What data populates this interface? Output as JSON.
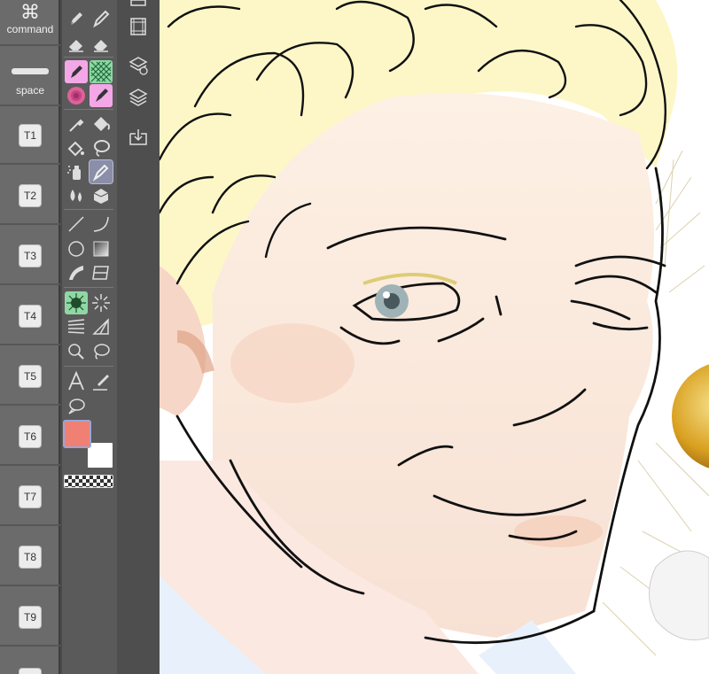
{
  "shortcuts": {
    "command": {
      "glyph": "⌘",
      "label": "command"
    },
    "space": {
      "label": "space"
    },
    "keys": [
      "T1",
      "T2",
      "T3",
      "T4",
      "T5",
      "T6",
      "T7",
      "T8",
      "T9"
    ]
  },
  "colors": {
    "main_color": "#f08073",
    "sub_color": "#ffffff",
    "selected_tool": "#8a8ea8"
  },
  "icons": {
    "strip": [
      "film-icon",
      "layer-properties-icon",
      "layers-icon",
      "import-icon"
    ]
  }
}
